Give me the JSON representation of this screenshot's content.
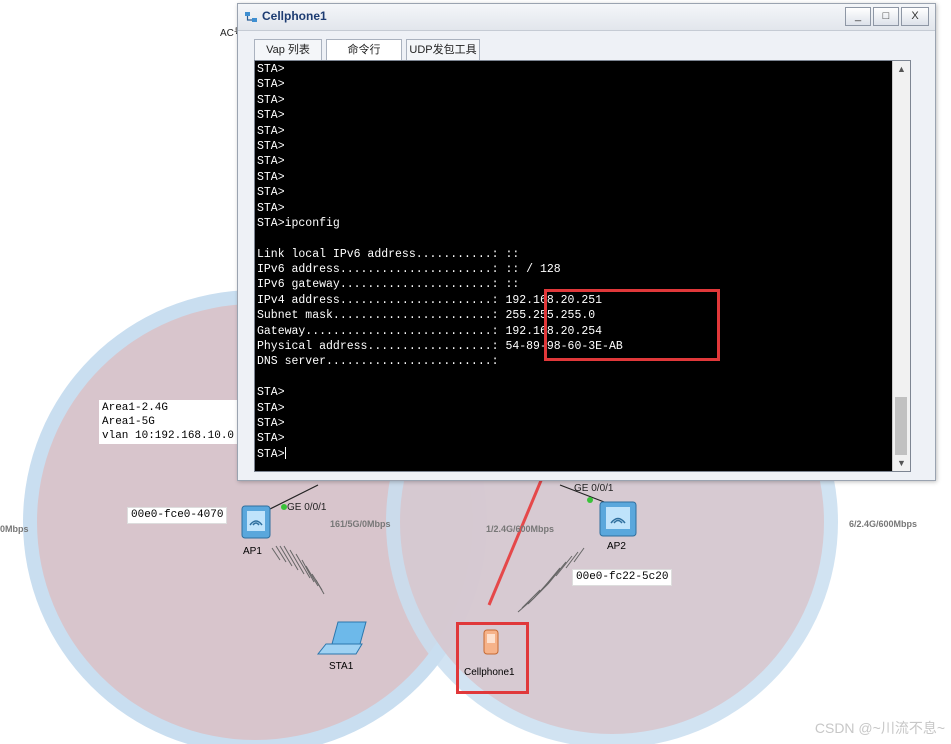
{
  "topology": {
    "labels": {
      "ac_partial": "AC号",
      "left_rate": "0Mbps",
      "link_ap1": "161/5G/0Mbps",
      "link_mid": "1/2.4G/600Mbps",
      "link_right": "6/2.4G/600Mbps",
      "ge_ap1": "GE 0/0/1",
      "ge_ap2": "GE 0/0/1"
    },
    "info_box": {
      "line1": "Area1-2.4G",
      "line2": "Area1-5G",
      "line3": "vlan 10:192.168.10.0"
    },
    "ap1": {
      "name": "AP1",
      "mac": "00e0-fce0-4070"
    },
    "ap2": {
      "name": "AP2",
      "mac": "00e0-fc22-5c20"
    },
    "sta1": {
      "name": "STA1"
    },
    "cellphone1": {
      "name": "Cellphone1"
    },
    "colors": {
      "highlight": "#e0383a",
      "coverage_ring": "#c7dcef",
      "coverage_fill": "#dcc8cf"
    }
  },
  "window": {
    "title": "Cellphone1",
    "controls": {
      "minimize": "_",
      "maximize": "□",
      "close": "X"
    },
    "tabs": [
      "Vap 列表",
      "命令行",
      "UDP发包工具"
    ],
    "terminal_lines": [
      "STA>",
      "STA>",
      "STA>",
      "STA>",
      "STA>",
      "STA>",
      "STA>",
      "STA>",
      "STA>",
      "STA>",
      "STA>ipconfig",
      "",
      "Link local IPv6 address...........: ::",
      "IPv6 address......................: :: / 128",
      "IPv6 gateway......................: ::",
      "IPv4 address......................: 192.168.20.251",
      "Subnet mask.......................: 255.255.255.0",
      "Gateway...........................: 192.168.20.254",
      "Physical address..................: 54-89-98-60-3E-AB",
      "DNS server........................:",
      "",
      "STA>",
      "STA>",
      "STA>",
      "STA>",
      "STA>"
    ]
  },
  "watermark": "CSDN @~川流不息~"
}
